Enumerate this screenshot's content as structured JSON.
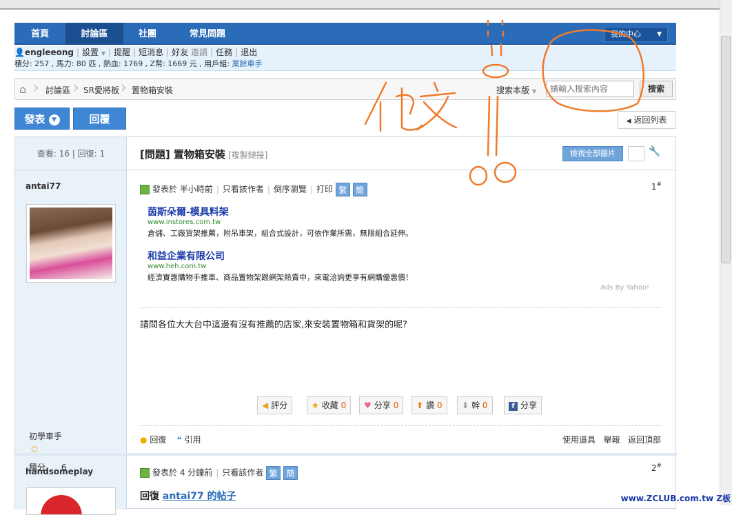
{
  "nav": {
    "items": [
      "首頁",
      "討論區",
      "社團",
      "常見問題"
    ],
    "my_center": "我的中心"
  },
  "userbar": {
    "username": "engleeong",
    "links": [
      "設置",
      "提醒",
      "短消息",
      "好友",
      "邀請",
      "任務",
      "退出"
    ],
    "stats": "積分: 257 , 馬力: 80 匹 , 熱血: 1769 , Z幣: 1669 元 , 用戶組:",
    "user_group": "業餘車手"
  },
  "breadcrumb": {
    "items": [
      "討論區",
      "SR愛將板",
      "置物箱安裝"
    ]
  },
  "search": {
    "scope": "搜索本版",
    "placeholder": "請輸入搜索內容",
    "button": "搜索"
  },
  "buttons": {
    "post": "發表",
    "reply": "回覆",
    "back_list": "返回列表"
  },
  "thread": {
    "stats": "查看: 16 | 回復: 1",
    "title": "[問題] 置物箱安裝",
    "copy_link": "[複製鏈接]",
    "view_images": "檢視全部圖片"
  },
  "post1": {
    "author": "antai77",
    "rank": "初學車手",
    "points_label": "積分",
    "points": "6",
    "meta": [
      "發表於 半小時前",
      "只看該作者",
      "倒序瀏覽",
      "打印"
    ],
    "trad": "繁",
    "simp": "簡",
    "floor": "1",
    "ads": [
      {
        "title": "茵斯朵爾-模具料架",
        "url": "www.instores.com.tw",
        "desc": "倉儲、工廠貨架推薦，附吊車架，組合式設計，可依作業所需，無限組合延伸。"
      },
      {
        "title": "和益企業有限公司",
        "url": "www.heh.com.tw",
        "desc": "經濟實惠購物手推車、商品置物架跟網架熱賣中，來電洽詢更享有網購優惠價！"
      }
    ],
    "ads_by": "Ads By Yahoo!",
    "body": "請問各位大大台中這邊有沒有推薦的店家,來安裝置物箱和貨架的呢?",
    "actions": [
      {
        "label": "評分",
        "count": ""
      },
      {
        "label": "收藏",
        "count": "0"
      },
      {
        "label": "分享",
        "count": "0"
      },
      {
        "label": "讚",
        "count": "0"
      },
      {
        "label": "幹",
        "count": "0"
      },
      {
        "label": "分享",
        "count": ""
      }
    ],
    "foot_left": [
      "回復",
      "引用"
    ],
    "foot_right": [
      "使用道具",
      "舉報",
      "返回頂部"
    ]
  },
  "post2": {
    "author": "handsomeplay",
    "meta": [
      "發表於 4 分鐘前",
      "只看該作者"
    ],
    "trad": "繁",
    "simp": "簡",
    "floor": "2",
    "reply_prefix": "回復",
    "reply_link": "antai77 的帖子"
  },
  "annotation": {
    "handwritten": "他文"
  },
  "watermark": "www.ZCLUB.com.tw Z板",
  "colors": {
    "nav": "#2b6cb8",
    "annotation": "#f07a2a",
    "count": "#e35c00"
  }
}
